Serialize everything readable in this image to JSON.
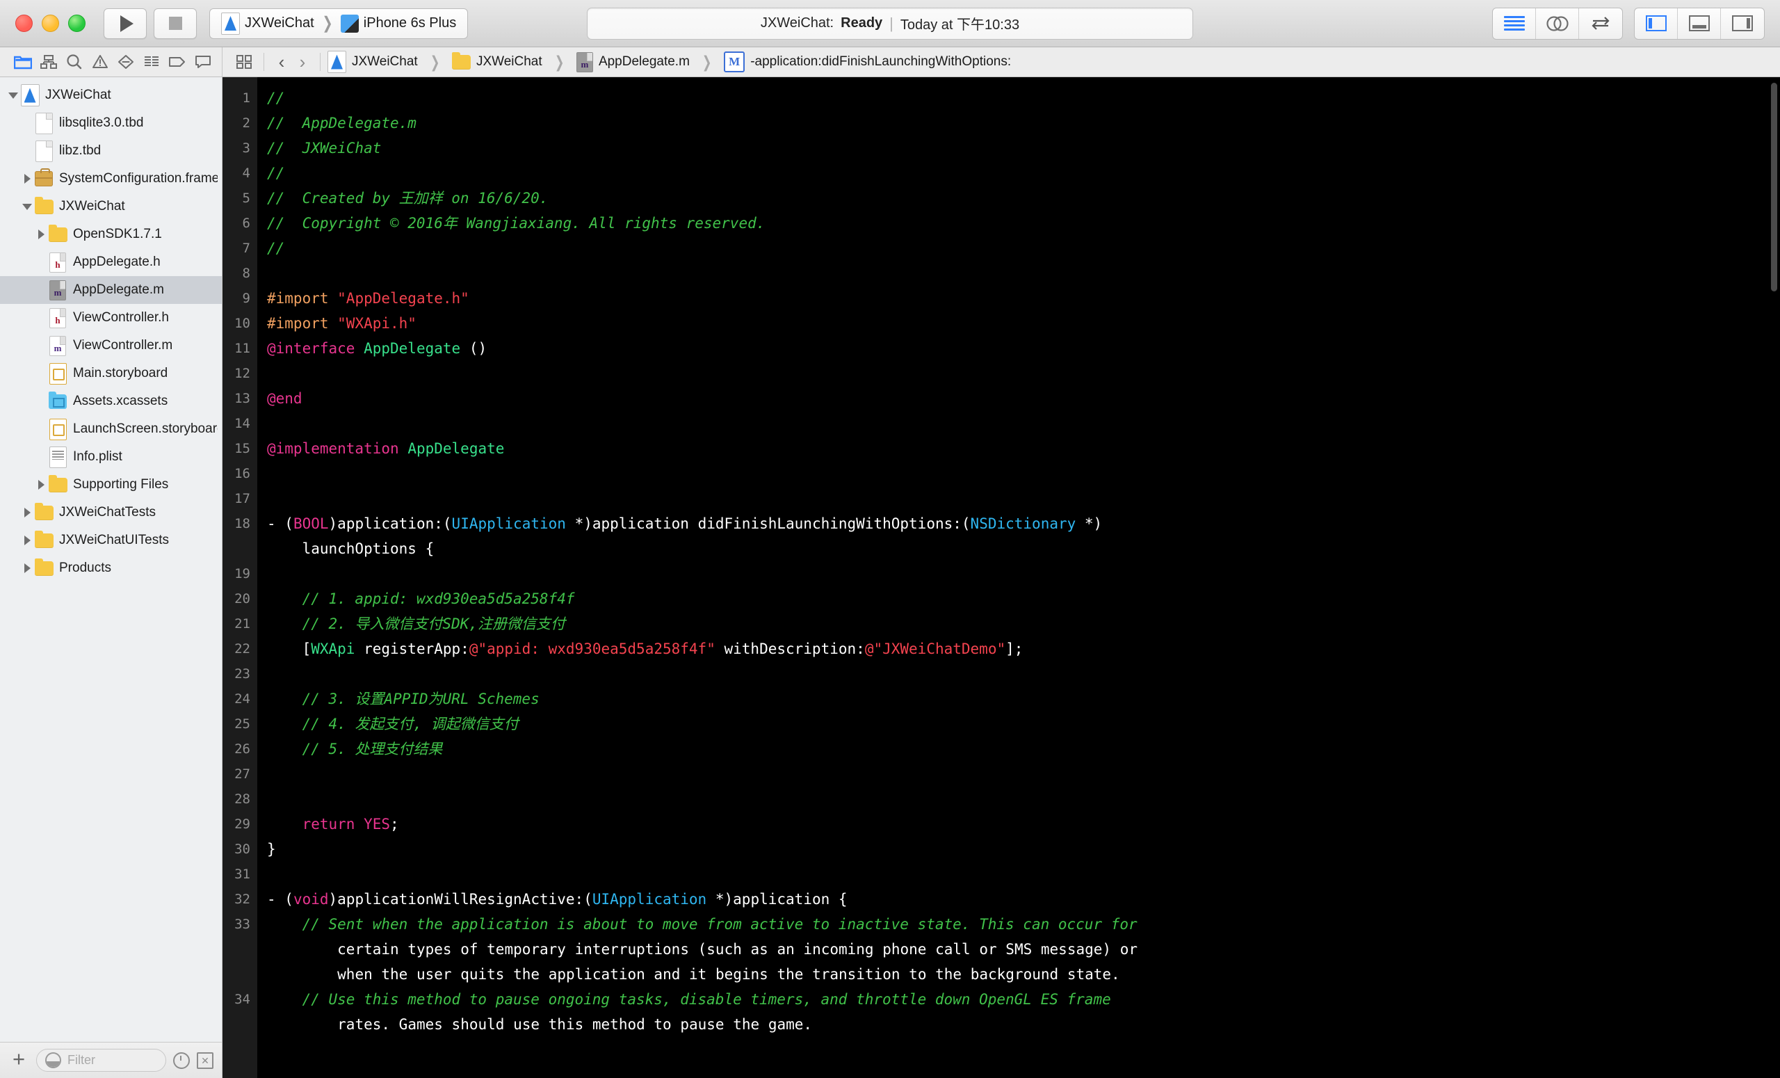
{
  "window": {
    "traffic_lights": [
      "close",
      "minimize",
      "zoom"
    ]
  },
  "toolbar": {
    "run_label": "Run",
    "stop_label": "Stop",
    "scheme_project": "JXWeiChat",
    "scheme_destination": "iPhone 6s Plus",
    "status_project": "JXWeiChat:",
    "status_state": "Ready",
    "status_divider": "|",
    "status_time": "Today at 下午10:33",
    "editor_standard": "standard-editor",
    "editor_assistant": "assistant-editor",
    "editor_version": "version-editor",
    "view_navigator": "toggle-navigator",
    "view_debug": "toggle-debug-area",
    "view_utilities": "toggle-utilities"
  },
  "navigator_tabs": [
    {
      "name": "project-navigator",
      "active": true
    },
    {
      "name": "symbol-navigator",
      "active": false
    },
    {
      "name": "find-navigator",
      "active": false
    },
    {
      "name": "issue-navigator",
      "active": false
    },
    {
      "name": "test-navigator",
      "active": false
    },
    {
      "name": "debug-navigator",
      "active": false
    },
    {
      "name": "breakpoint-navigator",
      "active": false
    },
    {
      "name": "report-navigator",
      "active": false
    }
  ],
  "jump_bar": {
    "back_glyph": "‹",
    "forward_glyph": "›",
    "crumbs": [
      {
        "label": "JXWeiChat",
        "icon": "xcode-project-icon"
      },
      {
        "label": "JXWeiChat",
        "icon": "folder-icon"
      },
      {
        "label": "AppDelegate.m",
        "icon": "objc-file-icon"
      },
      {
        "label": "-application:didFinishLaunchingWithOptions:",
        "icon": "method-marker-icon"
      }
    ]
  },
  "file_tree": [
    {
      "label": "JXWeiChat",
      "indent": 0,
      "twisty": "down",
      "icon": "xcode-project-icon",
      "selected": false
    },
    {
      "label": "libsqlite3.0.tbd",
      "indent": 1,
      "twisty": "none",
      "icon": "document-icon",
      "selected": false
    },
    {
      "label": "libz.tbd",
      "indent": 1,
      "twisty": "none",
      "icon": "document-icon",
      "selected": false
    },
    {
      "label": "SystemConfiguration.framework",
      "indent": 1,
      "twisty": "right",
      "icon": "framework-icon",
      "selected": false
    },
    {
      "label": "JXWeiChat",
      "indent": 1,
      "twisty": "down",
      "icon": "folder-icon",
      "selected": false
    },
    {
      "label": "OpenSDK1.7.1",
      "indent": 2,
      "twisty": "right",
      "icon": "folder-icon",
      "selected": false
    },
    {
      "label": "AppDelegate.h",
      "indent": 2,
      "twisty": "none",
      "icon": "header-file-icon",
      "selected": false
    },
    {
      "label": "AppDelegate.m",
      "indent": 2,
      "twisty": "none",
      "icon": "objc-file-icon-selected",
      "selected": true
    },
    {
      "label": "ViewController.h",
      "indent": 2,
      "twisty": "none",
      "icon": "header-file-icon",
      "selected": false
    },
    {
      "label": "ViewController.m",
      "indent": 2,
      "twisty": "none",
      "icon": "objc-file-icon",
      "selected": false
    },
    {
      "label": "Main.storyboard",
      "indent": 2,
      "twisty": "none",
      "icon": "storyboard-icon",
      "selected": false
    },
    {
      "label": "Assets.xcassets",
      "indent": 2,
      "twisty": "none",
      "icon": "assets-icon",
      "selected": false
    },
    {
      "label": "LaunchScreen.storyboard",
      "indent": 2,
      "twisty": "none",
      "icon": "storyboard-icon",
      "selected": false
    },
    {
      "label": "Info.plist",
      "indent": 2,
      "twisty": "none",
      "icon": "plist-icon",
      "selected": false
    },
    {
      "label": "Supporting Files",
      "indent": 2,
      "twisty": "right",
      "icon": "folder-icon",
      "selected": false
    },
    {
      "label": "JXWeiChatTests",
      "indent": 1,
      "twisty": "right",
      "icon": "folder-icon",
      "selected": false
    },
    {
      "label": "JXWeiChatUITests",
      "indent": 1,
      "twisty": "right",
      "icon": "folder-icon",
      "selected": false
    },
    {
      "label": "Products",
      "indent": 1,
      "twisty": "right",
      "icon": "folder-icon",
      "selected": false
    }
  ],
  "filter_bar": {
    "add_label": "+",
    "placeholder": "Filter",
    "recent_icon": "clock-icon",
    "source-control_icon": "source-control-icon"
  },
  "editor": {
    "file_name": "AppDelegate.m",
    "theme": {
      "background": "#000000",
      "gutter_background": "#1c1c1c",
      "gutter_text": "#8e8e8e",
      "plain": "#ffffff",
      "comment": "#41c24a",
      "preprocessor": "#f0a060",
      "string": "#f4434f",
      "keyword": "#e8358f",
      "type": "#38e08b",
      "system_type": "#2fb6f0"
    },
    "line_numbers": [
      1,
      2,
      3,
      4,
      5,
      6,
      7,
      8,
      9,
      10,
      11,
      12,
      13,
      14,
      15,
      16,
      17,
      18,
      19,
      20,
      21,
      22,
      23,
      24,
      25,
      26,
      27,
      28,
      29,
      30,
      31,
      32,
      33,
      34
    ],
    "lines": [
      {
        "n": 1,
        "text": "//"
      },
      {
        "n": 2,
        "text": "//  AppDelegate.m"
      },
      {
        "n": 3,
        "text": "//  JXWeiChat"
      },
      {
        "n": 4,
        "text": "//"
      },
      {
        "n": 5,
        "text": "//  Created by 王加祥 on 16/6/20."
      },
      {
        "n": 6,
        "text": "//  Copyright © 2016年 Wangjiaxiang. All rights reserved."
      },
      {
        "n": 7,
        "text": "//"
      },
      {
        "n": 8,
        "text": ""
      },
      {
        "n": 9,
        "text": "#import \"AppDelegate.h\""
      },
      {
        "n": 10,
        "text": "#import \"WXApi.h\""
      },
      {
        "n": 11,
        "text": "@interface AppDelegate ()"
      },
      {
        "n": 12,
        "text": ""
      },
      {
        "n": 13,
        "text": "@end"
      },
      {
        "n": 14,
        "text": ""
      },
      {
        "n": 15,
        "text": "@implementation AppDelegate"
      },
      {
        "n": 16,
        "text": ""
      },
      {
        "n": 17,
        "text": ""
      },
      {
        "n": 18,
        "text": "- (BOOL)application:(UIApplication *)application didFinishLaunchingWithOptions:(NSDictionary *)\n    launchOptions {"
      },
      {
        "n": 19,
        "text": ""
      },
      {
        "n": 20,
        "text": "    // 1. appid: wxd930ea5d5a258f4f"
      },
      {
        "n": 21,
        "text": "    // 2. 导入微信支付SDK,注册微信支付"
      },
      {
        "n": 22,
        "text": "    [WXApi registerApp:@\"appid: wxd930ea5d5a258f4f\" withDescription:@\"JXWeiChatDemo\"];"
      },
      {
        "n": 23,
        "text": ""
      },
      {
        "n": 24,
        "text": "    // 3. 设置APPID为URL Schemes"
      },
      {
        "n": 25,
        "text": "    // 4. 发起支付, 调起微信支付"
      },
      {
        "n": 26,
        "text": "    // 5. 处理支付结果"
      },
      {
        "n": 27,
        "text": ""
      },
      {
        "n": 28,
        "text": ""
      },
      {
        "n": 29,
        "text": "    return YES;"
      },
      {
        "n": 30,
        "text": "}"
      },
      {
        "n": 31,
        "text": ""
      },
      {
        "n": 32,
        "text": "- (void)applicationWillResignActive:(UIApplication *)application {"
      },
      {
        "n": 33,
        "text": "    // Sent when the application is about to move from active to inactive state. This can occur for\n        certain types of temporary interruptions (such as an incoming phone call or SMS message) or\n        when the user quits the application and it begins the transition to the background state."
      },
      {
        "n": 34,
        "text": "    // Use this method to pause ongoing tasks, disable timers, and throttle down OpenGL ES frame\n        rates. Games should use this method to pause the game."
      }
    ]
  }
}
